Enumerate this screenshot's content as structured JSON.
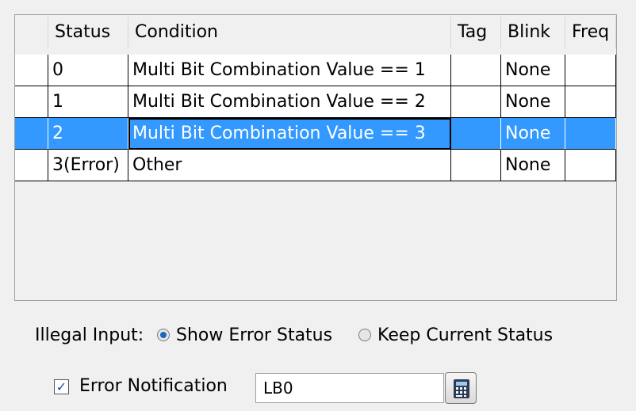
{
  "table": {
    "headers": {
      "status": "Status",
      "condition": "Condition",
      "tag": "Tag",
      "blink": "Blink",
      "freq": "Freq"
    },
    "rows": [
      {
        "status": "0",
        "condition": "Multi Bit Combination Value == 1",
        "tag": "",
        "blink": "None",
        "freq": ""
      },
      {
        "status": "1",
        "condition": "Multi Bit Combination Value == 2",
        "tag": "",
        "blink": "None",
        "freq": ""
      },
      {
        "status": "2",
        "condition": "Multi Bit Combination Value == 3",
        "tag": "",
        "blink": "None",
        "freq": ""
      },
      {
        "status": "3(Error)",
        "condition": "Other",
        "tag": "",
        "blink": "None",
        "freq": ""
      }
    ],
    "selected_row": 2
  },
  "illegal_input": {
    "label": "Illegal Input:",
    "option_show": "Show Error Status",
    "option_keep": "Keep Current Status",
    "selected": "Show Error Status"
  },
  "error_notification": {
    "label": "Error Notification",
    "checked": true,
    "address": "LB0"
  },
  "colors": {
    "selection": "#3399ff",
    "radio_dot": "#1a68b8"
  },
  "icons": {
    "address_button": "calculator-icon"
  }
}
